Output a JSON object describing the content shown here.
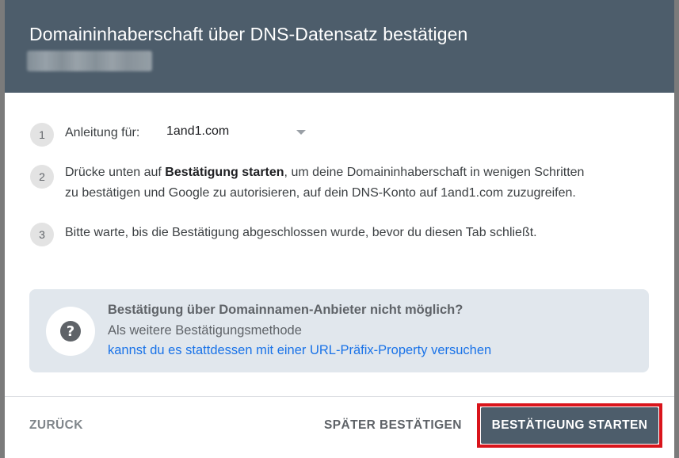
{
  "dialog": {
    "title": "Domaininhaberschaft über DNS-Datensatz bestätigen"
  },
  "steps": [
    {
      "number": "1",
      "label": "Anleitung für:",
      "provider_value": "1and1.com"
    },
    {
      "number": "2",
      "text_before": "Drücke unten auf ",
      "text_bold": "Bestätigung starten",
      "text_after_line1": ", um deine Domaininhaberschaft in wenigen Schritten",
      "text_line2": "zu bestätigen und Google zu autorisieren, auf dein DNS-Konto auf 1and1.com zuzugreifen."
    },
    {
      "number": "3",
      "text": "Bitte warte, bis die Bestätigung abgeschlossen wurde, bevor du diesen Tab schließt."
    }
  ],
  "info_box": {
    "icon": "question-mark-icon",
    "title": "Bestätigung über Domainnamen-Anbieter nicht möglich?",
    "line": "Als weitere Bestätigungsmethode",
    "link": "kannst du es stattdessen mit einer URL-Präfix-Property versuchen"
  },
  "footer": {
    "back_label": "ZURÜCK",
    "later_label": "SPÄTER BESTÄTIGEN",
    "start_label": "BESTÄTIGUNG STARTEN"
  },
  "colors": {
    "header_bg": "#4d5d6b",
    "link": "#1a73e8",
    "highlight_border": "#d9141b"
  }
}
